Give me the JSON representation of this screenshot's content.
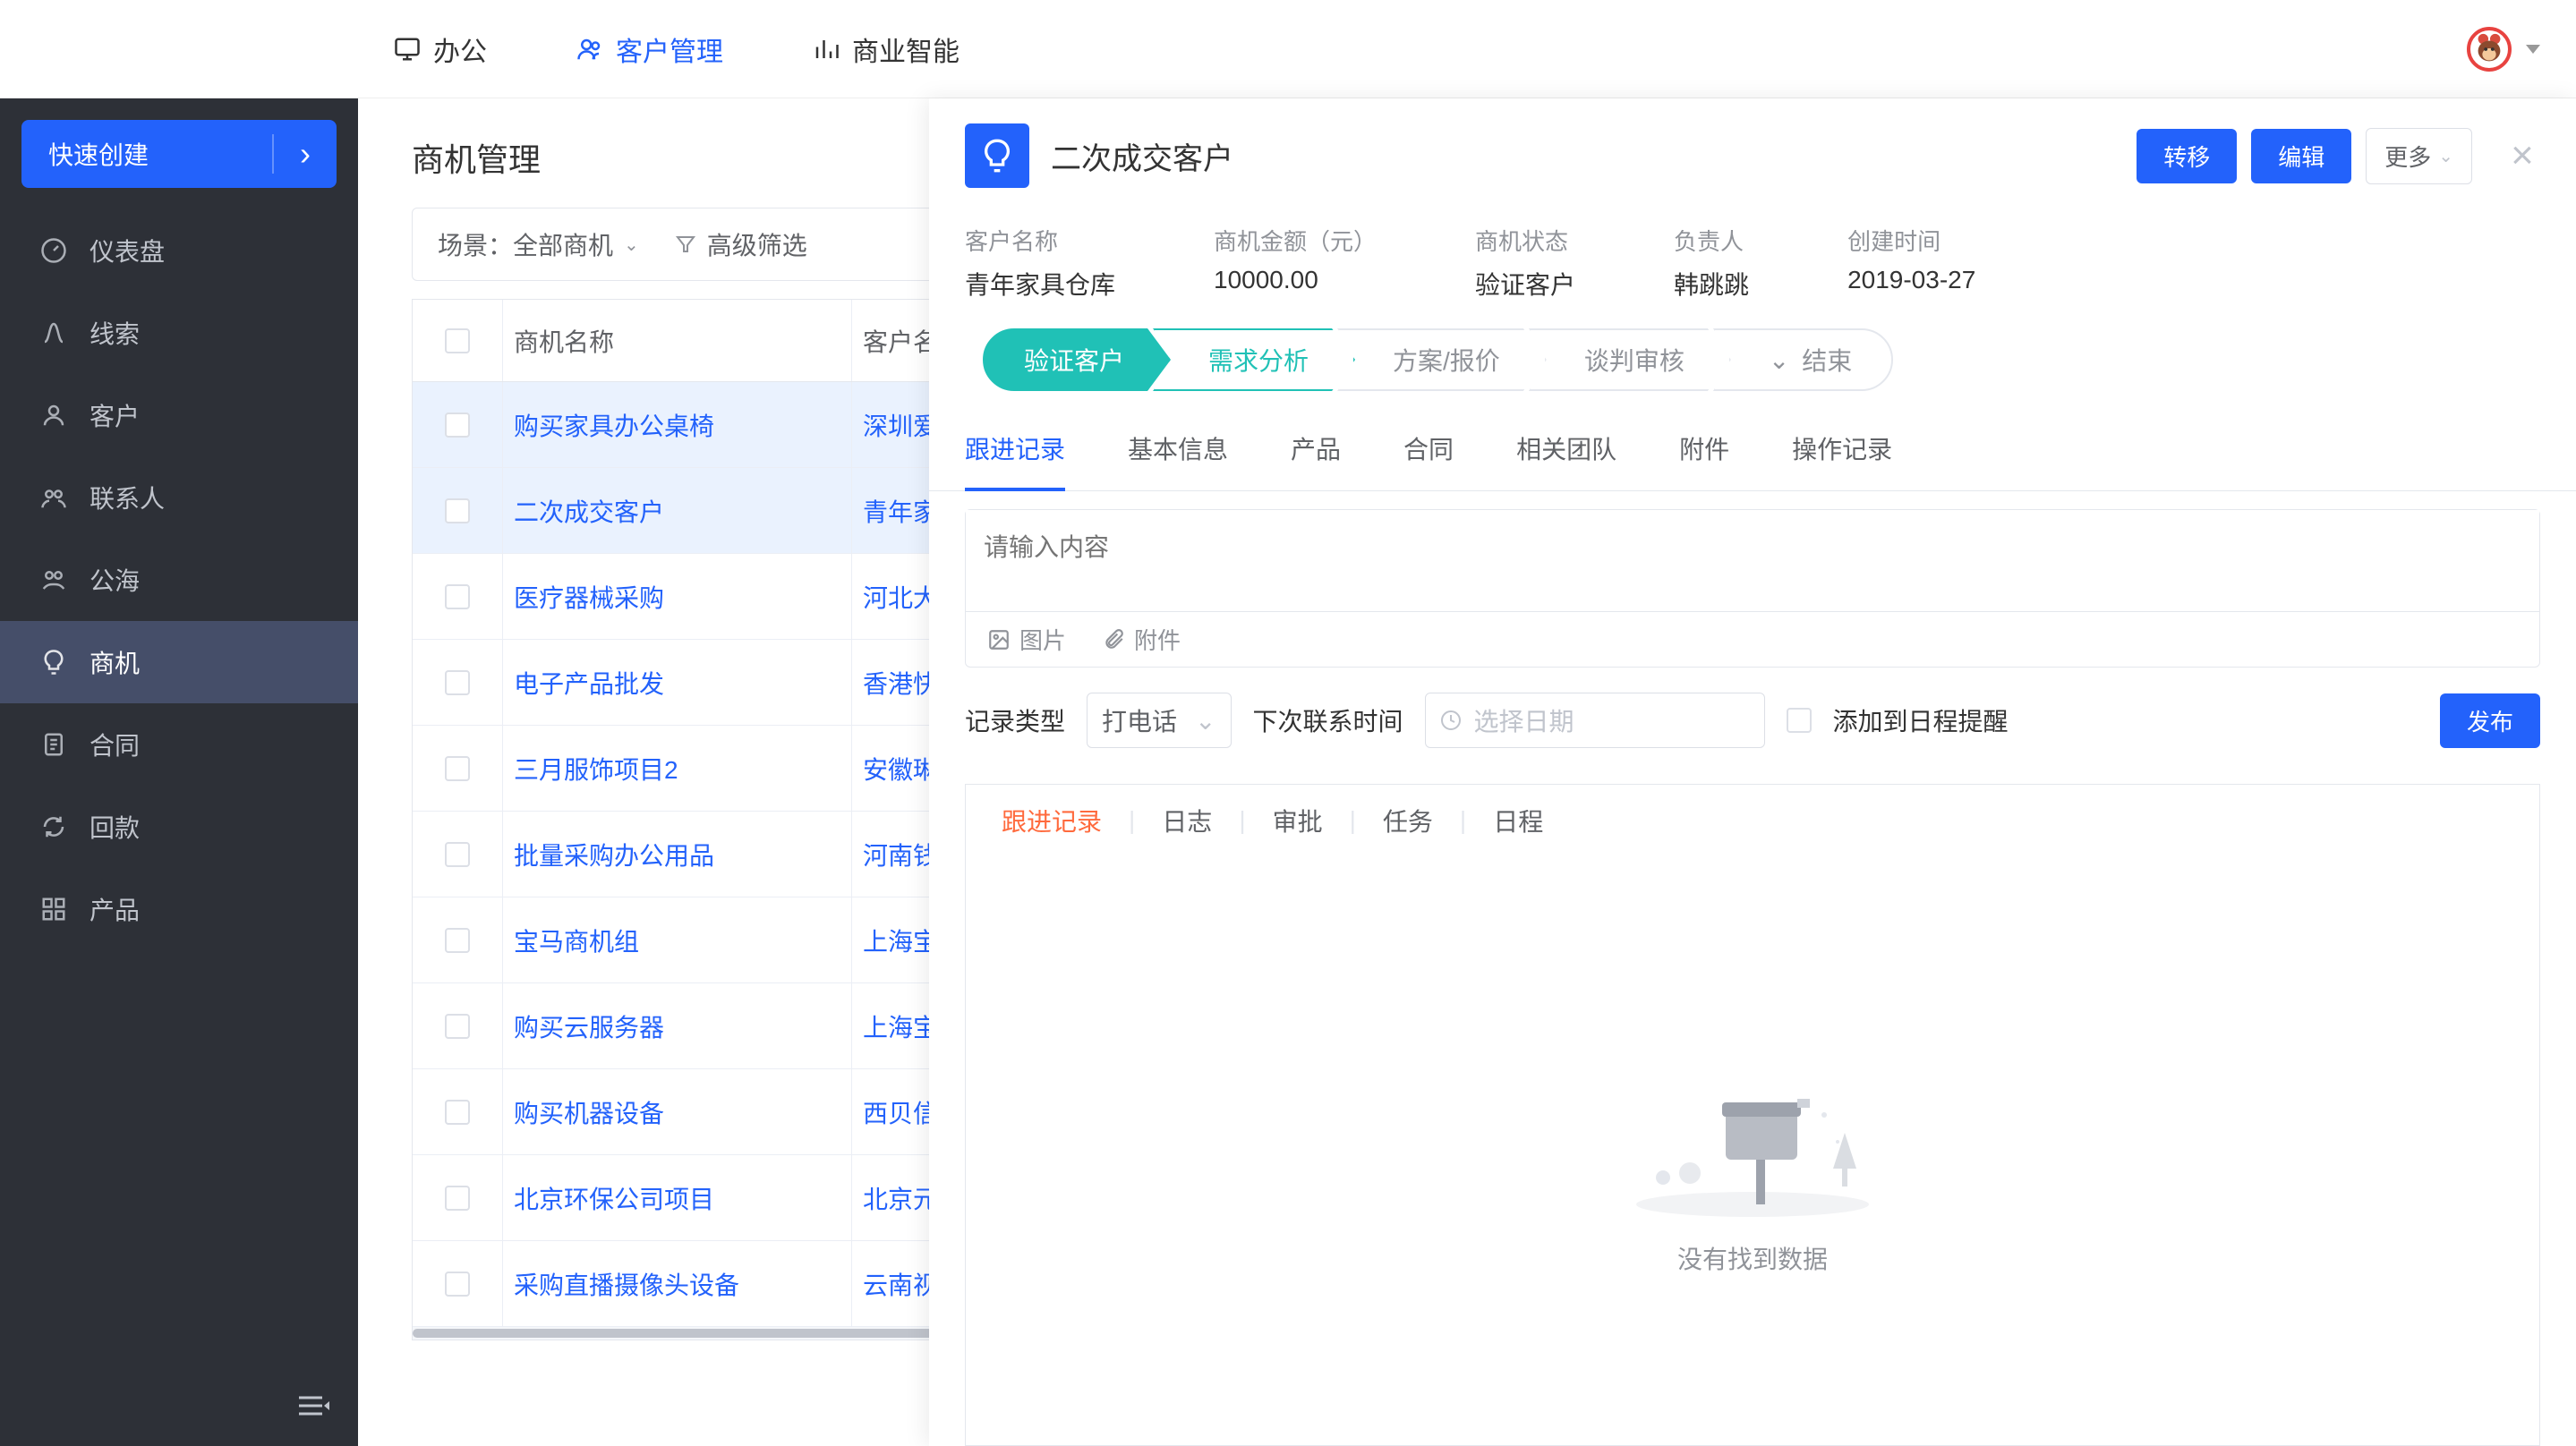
{
  "topnav": {
    "office": "办公",
    "crm": "客户管理",
    "bi": "商业智能"
  },
  "sidebar": {
    "quick_create": "快速创建",
    "items": [
      {
        "label": "仪表盘"
      },
      {
        "label": "线索"
      },
      {
        "label": "客户"
      },
      {
        "label": "联系人"
      },
      {
        "label": "公海"
      },
      {
        "label": "商机"
      },
      {
        "label": "合同"
      },
      {
        "label": "回款"
      },
      {
        "label": "产品"
      }
    ]
  },
  "main": {
    "title": "商机管理",
    "scene_label": "场景：全部商机",
    "filter_label": "高级筛选",
    "columns": {
      "name": "商机名称",
      "customer": "客户名"
    },
    "rows": [
      {
        "name": "购买家具办公桌椅",
        "customer": "深圳爱",
        "selected": true
      },
      {
        "name": "二次成交客户",
        "customer": "青年家",
        "selected": true
      },
      {
        "name": "医疗器械采购",
        "customer": "河北大",
        "selected": false
      },
      {
        "name": "电子产品批发",
        "customer": "香港快",
        "selected": false
      },
      {
        "name": "三月服饰项目2",
        "customer": "安徽琳",
        "selected": false
      },
      {
        "name": "批量采购办公用品",
        "customer": "河南钱",
        "selected": false
      },
      {
        "name": "宝马商机组",
        "customer": "上海宝",
        "selected": false
      },
      {
        "name": "购买云服务器",
        "customer": "上海宝",
        "selected": false
      },
      {
        "name": "购买机器设备",
        "customer": "西贝信",
        "selected": false
      },
      {
        "name": "北京环保公司项目",
        "customer": "北京元",
        "selected": false
      },
      {
        "name": "采购直播摄像头设备",
        "customer": "云南视",
        "selected": false
      }
    ]
  },
  "detail": {
    "title": "二次成交客户",
    "actions": {
      "transfer": "转移",
      "edit": "编辑",
      "more": "更多"
    },
    "info": [
      {
        "label": "客户名称",
        "value": "青年家具仓库"
      },
      {
        "label": "商机金额（元）",
        "value": "10000.00"
      },
      {
        "label": "商机状态",
        "value": "验证客户"
      },
      {
        "label": "负责人",
        "value": "韩跳跳"
      },
      {
        "label": "创建时间",
        "value": "2019-03-27"
      }
    ],
    "stages": [
      {
        "label": "验证客户",
        "state": "done"
      },
      {
        "label": "需求分析",
        "state": "current"
      },
      {
        "label": "方案/报价",
        "state": ""
      },
      {
        "label": "谈判审核",
        "state": ""
      },
      {
        "label": "结束",
        "state": "last"
      }
    ],
    "tabs": [
      "跟进记录",
      "基本信息",
      "产品",
      "合同",
      "相关团队",
      "附件",
      "操作记录"
    ],
    "editor": {
      "placeholder": "请输入内容",
      "image": "图片",
      "attachment": "附件"
    },
    "meta": {
      "record_type_label": "记录类型",
      "record_type_value": "打电话",
      "next_contact_label": "下次联系时间",
      "date_placeholder": "选择日期",
      "add_schedule": "添加到日程提醒",
      "publish": "发布"
    },
    "subtabs": [
      "跟进记录",
      "日志",
      "审批",
      "任务",
      "日程"
    ],
    "empty": "没有找到数据"
  }
}
